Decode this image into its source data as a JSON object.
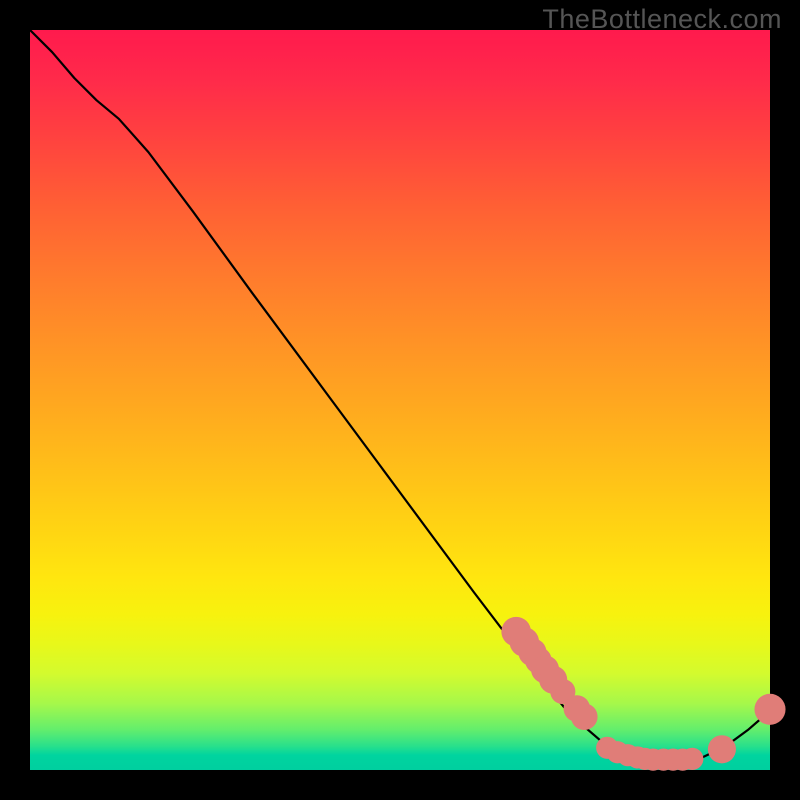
{
  "watermark": "TheBottleneck.com",
  "colors": {
    "background": "#000000",
    "gradient_top": "#ff1a4d",
    "gradient_bottom": "#00cf9f",
    "curve_stroke": "#000000",
    "marker_fill": "#e07d78"
  },
  "chart_data": {
    "type": "line",
    "title": "",
    "xlabel": "",
    "ylabel": "",
    "xlim": [
      0,
      100
    ],
    "ylim": [
      0,
      100
    ],
    "curve": [
      {
        "x": 0,
        "y": 100
      },
      {
        "x": 3,
        "y": 97
      },
      {
        "x": 6,
        "y": 93.5
      },
      {
        "x": 9,
        "y": 90.5
      },
      {
        "x": 12,
        "y": 88
      },
      {
        "x": 16,
        "y": 83.5
      },
      {
        "x": 22,
        "y": 75.5
      },
      {
        "x": 30,
        "y": 64.5
      },
      {
        "x": 40,
        "y": 51
      },
      {
        "x": 50,
        "y": 37.5
      },
      {
        "x": 60,
        "y": 24
      },
      {
        "x": 68,
        "y": 13.5
      },
      {
        "x": 73,
        "y": 7.5
      },
      {
        "x": 78,
        "y": 3.2
      },
      {
        "x": 82,
        "y": 1.4
      },
      {
        "x": 86,
        "y": 0.8
      },
      {
        "x": 90,
        "y": 1.3
      },
      {
        "x": 94,
        "y": 3.2
      },
      {
        "x": 97,
        "y": 5.4
      },
      {
        "x": 100,
        "y": 8.0
      }
    ],
    "markers_upper": [
      {
        "x": 65.7,
        "y": 18.7,
        "r": 4.0
      },
      {
        "x": 66.8,
        "y": 17.3,
        "r": 4.0
      },
      {
        "x": 67.9,
        "y": 15.9,
        "r": 3.8
      },
      {
        "x": 68.7,
        "y": 14.8,
        "r": 3.6
      },
      {
        "x": 69.6,
        "y": 13.6,
        "r": 3.8
      },
      {
        "x": 70.7,
        "y": 12.2,
        "r": 3.8
      },
      {
        "x": 72.0,
        "y": 10.6,
        "r": 3.4
      },
      {
        "x": 73.9,
        "y": 8.3,
        "r": 3.6
      },
      {
        "x": 74.9,
        "y": 7.2,
        "r": 3.6
      }
    ],
    "markers_lower": [
      {
        "x": 78.0,
        "y": 3.0,
        "r": 3.0
      },
      {
        "x": 79.4,
        "y": 2.4,
        "r": 3.0
      },
      {
        "x": 80.8,
        "y": 2.0,
        "r": 3.0
      },
      {
        "x": 82.1,
        "y": 1.7,
        "r": 3.0
      },
      {
        "x": 83.1,
        "y": 1.5,
        "r": 3.0
      },
      {
        "x": 84.2,
        "y": 1.4,
        "r": 3.0
      },
      {
        "x": 85.6,
        "y": 1.4,
        "r": 3.0
      },
      {
        "x": 86.9,
        "y": 1.4,
        "r": 3.0
      },
      {
        "x": 88.2,
        "y": 1.4,
        "r": 3.0
      },
      {
        "x": 89.5,
        "y": 1.5,
        "r": 3.0
      },
      {
        "x": 93.5,
        "y": 2.8,
        "r": 3.8
      },
      {
        "x": 100.0,
        "y": 8.2,
        "r": 4.2
      }
    ]
  }
}
